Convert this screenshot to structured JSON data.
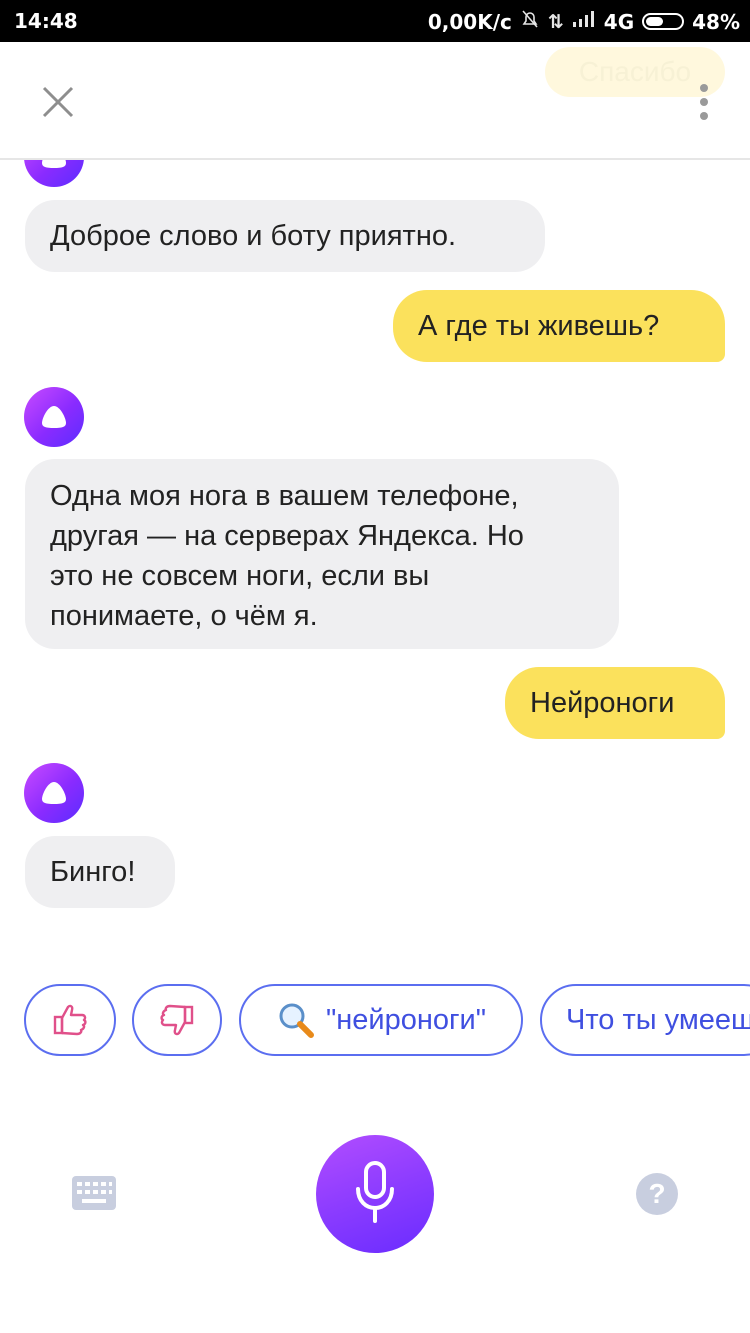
{
  "status_bar": {
    "time": "14:48",
    "net_speed": "0,00K/c",
    "network": "4G",
    "battery": "48%"
  },
  "header": {
    "ghost_bubble_text": "Спасибо"
  },
  "messages": [
    {
      "from": "bot",
      "text": "Доброе слово и боту приятно."
    },
    {
      "from": "user",
      "text": "А где ты живешь?"
    },
    {
      "from": "bot",
      "lines": [
        "Одна моя нога в вашем телефоне,",
        "другая — на серверах Яндекса. Но",
        "это не совсем ноги, если вы",
        "понимаете, о чём я."
      ]
    },
    {
      "from": "user",
      "text": "Нейроноги"
    },
    {
      "from": "bot",
      "text": "Бинго!"
    }
  ],
  "suggestions": {
    "search_chip": "\"нейроноги\"",
    "next_chip": "Что ты умеешь"
  },
  "bottom": {
    "help_glyph": "?"
  },
  "colors": {
    "accent": "#8a2bff",
    "user_bubble": "#fbe15c",
    "bot_bubble": "#efeff1",
    "chip_border": "#5b6ef0"
  },
  "icons": [
    "close-icon",
    "more-vert-icon",
    "alice-icon",
    "thumbs-up-icon",
    "thumbs-down-icon",
    "search-icon",
    "keyboard-icon",
    "microphone-icon",
    "help-icon"
  ]
}
